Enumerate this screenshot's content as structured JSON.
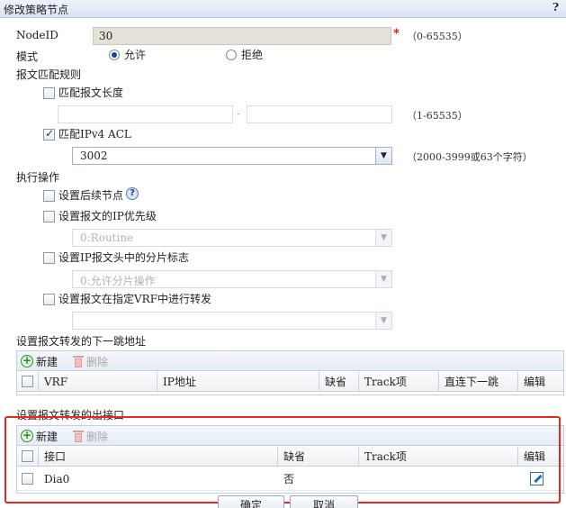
{
  "window": {
    "title": "修改策略节点",
    "help": "?"
  },
  "form": {
    "nodeid": {
      "label": "NodeID",
      "value": "30",
      "required_mark": "*",
      "hint": "（0-65535）"
    },
    "mode": {
      "label": "模式",
      "options": [
        {
          "label": "允许",
          "checked": true
        },
        {
          "label": "拒绝",
          "checked": false
        }
      ]
    },
    "match_section": {
      "label": "报文匹配规则"
    },
    "match_length": {
      "label": "匹配报文长度",
      "checked": false,
      "min_value": "",
      "max_value": "",
      "separator": "-",
      "hint": "（1-65535）"
    },
    "match_acl": {
      "label": "匹配IPv4 ACL",
      "checked": true,
      "value": "3002",
      "hint": "（2000-3999或63个字符）"
    },
    "action_section": {
      "label": "执行操作"
    },
    "next_node": {
      "label": "设置后续节点",
      "checked": false
    },
    "ip_precedence": {
      "label": "设置报文的IP优先级",
      "checked": false,
      "value": "0:Routine"
    },
    "fragment_flag": {
      "label": "设置IP报文头中的分片标志",
      "checked": false,
      "value": "0:允许分片操作"
    },
    "vrf_forward": {
      "label": "设置报文在指定VRF中进行转发",
      "checked": false,
      "value": ""
    }
  },
  "nexthop_table": {
    "label": "设置报文转发的下一跳地址",
    "toolbar": {
      "new_label": "新建",
      "delete_label": "删除"
    },
    "columns": [
      "VRF",
      "IP地址",
      "缺省",
      "Track项",
      "直连下一跳",
      "编辑"
    ],
    "rows": []
  },
  "outif_table": {
    "label": "设置报文转发的出接口",
    "toolbar": {
      "new_label": "新建",
      "delete_label": "删除"
    },
    "columns": [
      "接口",
      "缺省",
      "Track项",
      "编辑"
    ],
    "rows": [
      {
        "interface": "Dia0",
        "default": "否",
        "track": ""
      }
    ]
  },
  "buttons": {
    "ok_label": "确定",
    "cancel_label": "取消"
  },
  "colors": {
    "highlight_frame": "#e8271f",
    "title_bar": "#d9e4f3"
  }
}
